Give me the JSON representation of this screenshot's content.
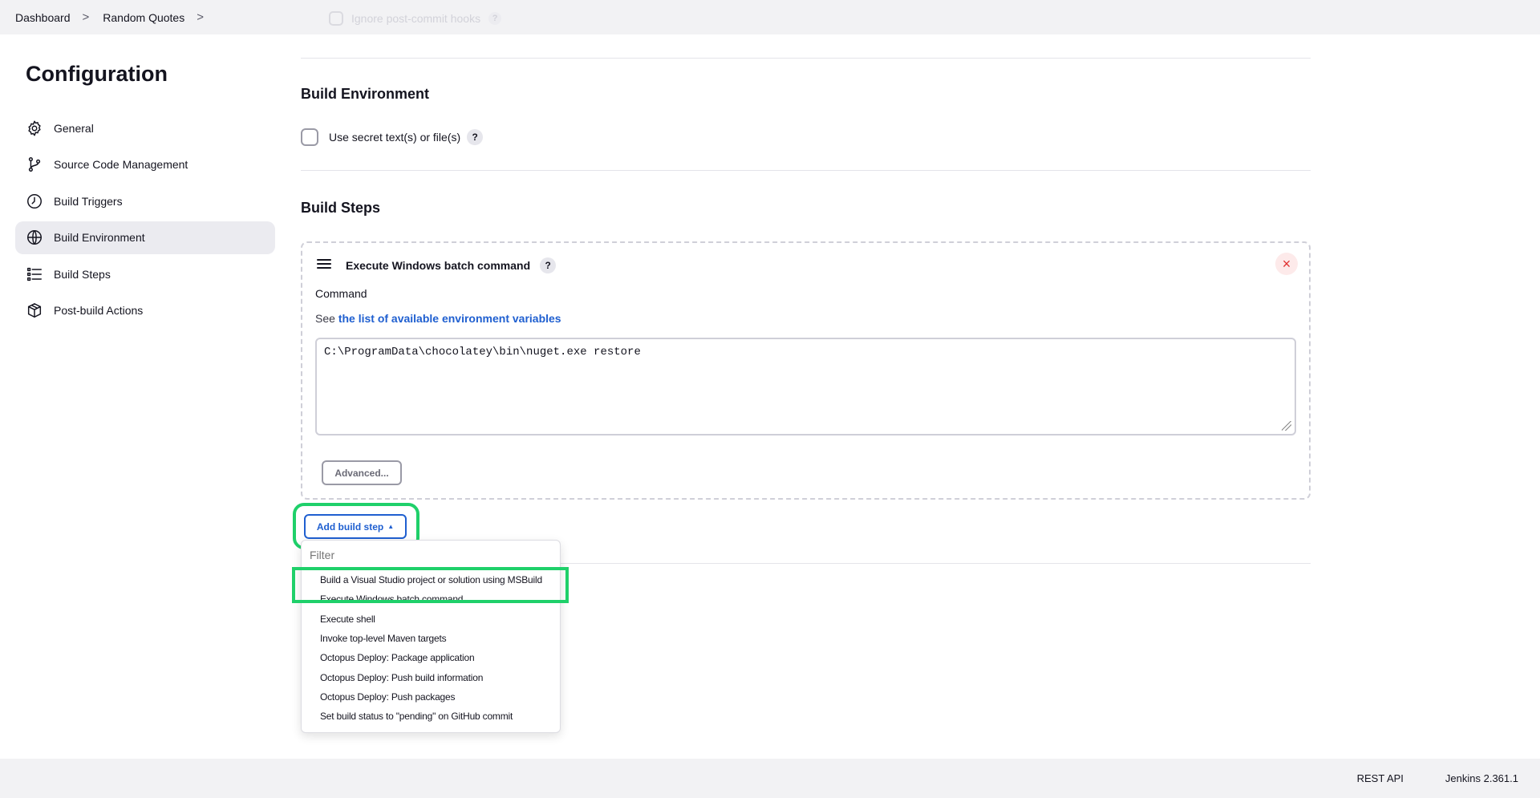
{
  "breadcrumb": {
    "items": [
      "Dashboard",
      "Random Quotes"
    ],
    "separator": ">"
  },
  "ghost_option": {
    "label": "Ignore post-commit hooks",
    "help": "?"
  },
  "sidebar": {
    "title": "Configuration",
    "items": [
      {
        "label": "General",
        "icon": "gear-icon"
      },
      {
        "label": "Source Code Management",
        "icon": "branch-icon"
      },
      {
        "label": "Build Triggers",
        "icon": "clock-icon"
      },
      {
        "label": "Build Environment",
        "icon": "globe-icon",
        "active": true
      },
      {
        "label": "Build Steps",
        "icon": "list-icon"
      },
      {
        "label": "Post-build Actions",
        "icon": "package-icon"
      }
    ]
  },
  "build_environment": {
    "title": "Build Environment",
    "secret_checkbox_label": "Use secret text(s) or file(s)",
    "help": "?"
  },
  "build_steps": {
    "title": "Build Steps",
    "step": {
      "title": "Execute Windows batch command",
      "help": "?",
      "close": "×",
      "command_label": "Command",
      "env_prefix": "See",
      "env_link": "the list of available environment variables",
      "command_value": "C:\\ProgramData\\chocolatey\\bin\\nuget.exe restore",
      "advanced_label": "Advanced..."
    },
    "add_button_label": "Add build step",
    "add_button_caret": "▲",
    "dropdown": {
      "filter_placeholder": "Filter",
      "items": [
        "Build a Visual Studio project or solution using MSBuild",
        "Execute Windows batch command",
        "Execute shell",
        "Invoke top-level Maven targets",
        "Octopus Deploy: Package application",
        "Octopus Deploy: Push build information",
        "Octopus Deploy: Push packages",
        "Set build status to \"pending\" on GitHub commit"
      ]
    }
  },
  "highlight_color": "#1fd06a",
  "accent_color": "#1f5fd0",
  "footer": {
    "rest_api": "REST API",
    "version": "Jenkins 2.361.1"
  }
}
